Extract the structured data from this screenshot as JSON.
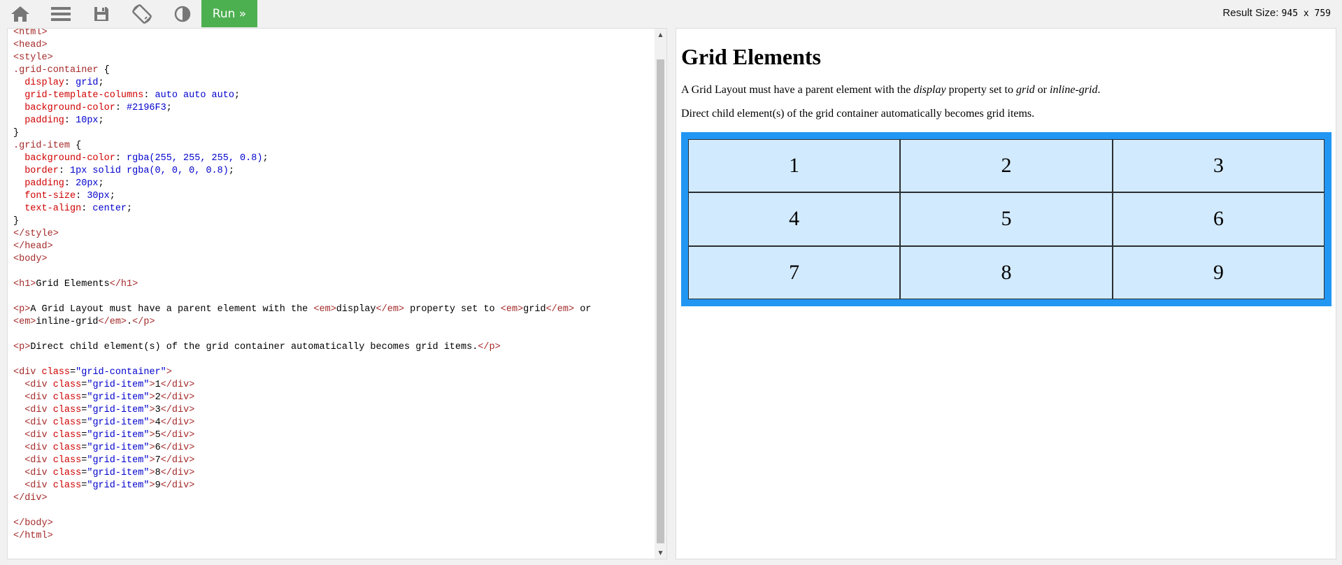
{
  "toolbar": {
    "icons": [
      "home-icon",
      "menu-icon",
      "save-icon",
      "rotate-icon",
      "contrast-icon"
    ],
    "run_label": "Run »",
    "result_size_label": "Result Size:",
    "result_width": "945",
    "result_sep": "x",
    "result_height": "759"
  },
  "colors": {
    "run_button": "#4caf50",
    "grid_container": "#2196F3",
    "toolbar_icon": "#777777"
  },
  "result": {
    "heading": "Grid Elements",
    "p1_before": "A Grid Layout must have a parent element with the ",
    "p1_em1": "display",
    "p1_mid": " property set to ",
    "p1_em2": "grid",
    "p1_or": " or ",
    "p1_em3": "inline-grid",
    "p1_end": ".",
    "p2": "Direct child element(s) of the grid container automatically becomes grid items.",
    "grid_items": [
      "1",
      "2",
      "3",
      "4",
      "5",
      "6",
      "7",
      "8",
      "9"
    ]
  }
}
